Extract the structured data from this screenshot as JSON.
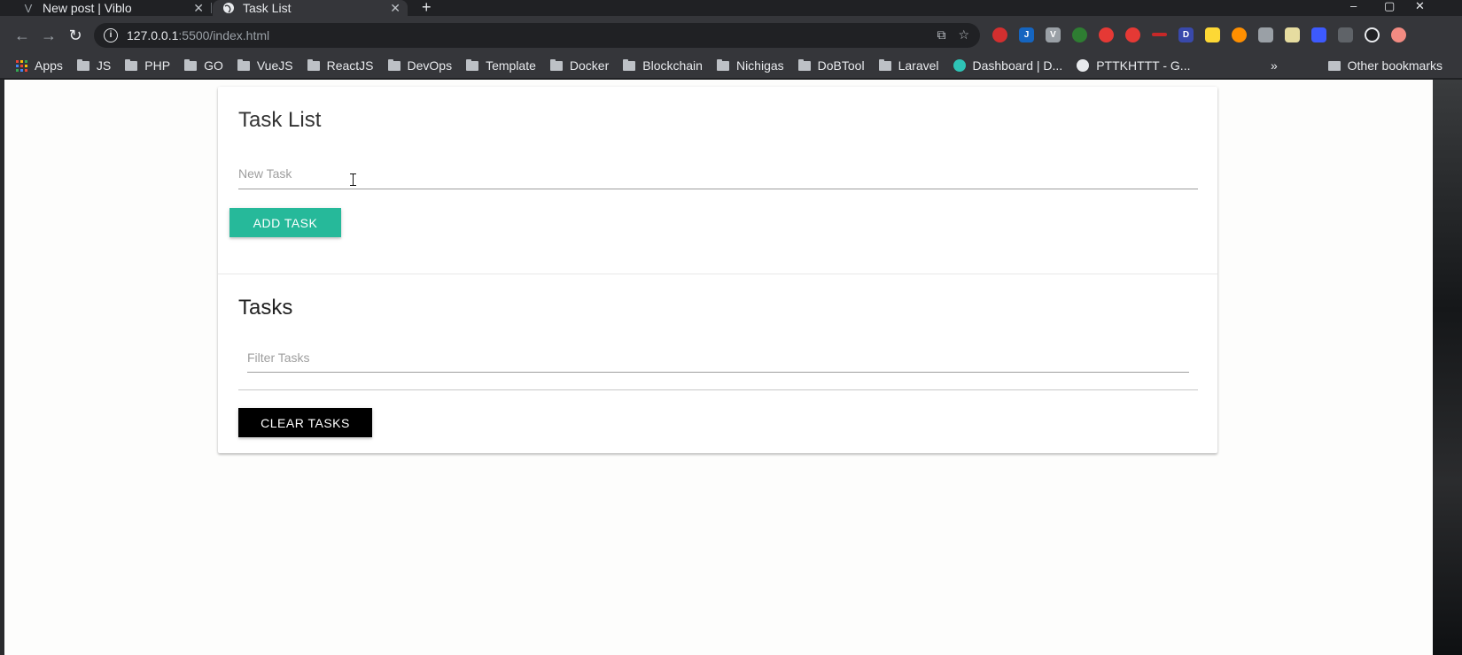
{
  "browser": {
    "tabs": [
      {
        "title": "New post | Viblo",
        "icon": "viblo-icon",
        "active": false
      },
      {
        "title": "Task List",
        "icon": "globe-icon",
        "active": true
      }
    ],
    "new_tab": "+",
    "window_controls": {
      "minimize": "–",
      "maximize": "▢",
      "close": "✕"
    },
    "nav": {
      "back": "←",
      "forward": "→",
      "reload": "↻"
    },
    "url": {
      "host": "127.0.0.1",
      "path": ":5500/index.html"
    },
    "omnibox_icons": {
      "translate": "⧉",
      "star": "☆"
    },
    "bookmarks": [
      {
        "label": "Apps",
        "type": "apps"
      },
      {
        "label": "JS",
        "type": "folder"
      },
      {
        "label": "PHP",
        "type": "folder"
      },
      {
        "label": "GO",
        "type": "folder"
      },
      {
        "label": "VueJS",
        "type": "folder"
      },
      {
        "label": "ReactJS",
        "type": "folder"
      },
      {
        "label": "DevOps",
        "type": "folder"
      },
      {
        "label": "Template",
        "type": "folder"
      },
      {
        "label": "Docker",
        "type": "folder"
      },
      {
        "label": "Blockchain",
        "type": "folder"
      },
      {
        "label": "Nichigas",
        "type": "folder"
      },
      {
        "label": "DoBTool",
        "type": "folder"
      },
      {
        "label": "Laravel",
        "type": "folder"
      },
      {
        "label": "Dashboard | D...",
        "type": "site"
      },
      {
        "label": "PTTKHTTT - G...",
        "type": "globe"
      }
    ],
    "bookmarks_overflow": "»",
    "other_bookmarks": "Other bookmarks"
  },
  "app": {
    "title": "Task List",
    "new_task_placeholder": "New Task",
    "add_button": "ADD TASK",
    "tasks_heading": "Tasks",
    "filter_placeholder": "Filter Tasks",
    "clear_button": "CLEAR TASKS"
  },
  "colors": {
    "add_button": "#26b99a",
    "clear_button": "#000000"
  }
}
